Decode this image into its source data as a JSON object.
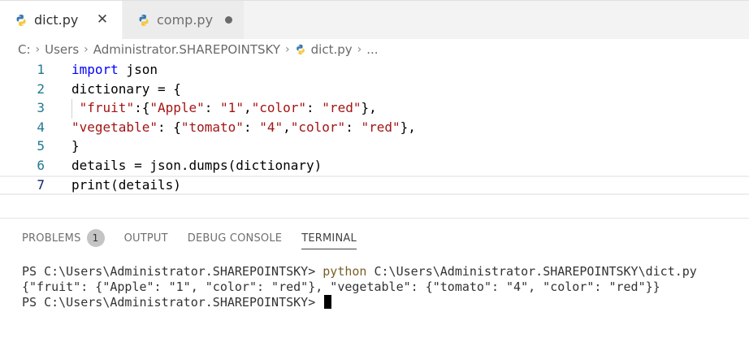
{
  "tabs": [
    {
      "label": "dict.py",
      "icon": "python-icon",
      "active": true,
      "close_symbol": "✕"
    },
    {
      "label": "comp.py",
      "icon": "python-icon",
      "active": false,
      "modified": true
    }
  ],
  "breadcrumb": {
    "items": [
      "C:",
      "Users",
      "Administrator.SHAREPOINTSKY",
      "dict.py",
      "..."
    ],
    "separator": "›"
  },
  "editor": {
    "lines": [
      {
        "number": "1",
        "parts": [
          {
            "t": "import",
            "c": "kw"
          },
          {
            "t": " json",
            "c": ""
          }
        ]
      },
      {
        "number": "2",
        "parts": [
          {
            "t": "dictionary = {",
            "c": ""
          }
        ]
      },
      {
        "number": "3",
        "parts": [
          {
            "t": " ",
            "c": ""
          },
          {
            "t": "\"fruit\"",
            "c": "str"
          },
          {
            "t": ":{",
            "c": ""
          },
          {
            "t": "\"Apple\"",
            "c": "str"
          },
          {
            "t": ": ",
            "c": ""
          },
          {
            "t": "\"1\"",
            "c": "str"
          },
          {
            "t": ",",
            "c": ""
          },
          {
            "t": "\"color\"",
            "c": "str"
          },
          {
            "t": ": ",
            "c": ""
          },
          {
            "t": "\"red\"",
            "c": "str"
          },
          {
            "t": "},",
            "c": ""
          }
        ]
      },
      {
        "number": "4",
        "parts": [
          {
            "t": "\"vegetable\"",
            "c": "str"
          },
          {
            "t": ": {",
            "c": ""
          },
          {
            "t": "\"tomato\"",
            "c": "str"
          },
          {
            "t": ": ",
            "c": ""
          },
          {
            "t": "\"4\"",
            "c": "str"
          },
          {
            "t": ",",
            "c": ""
          },
          {
            "t": "\"color\"",
            "c": "str"
          },
          {
            "t": ": ",
            "c": ""
          },
          {
            "t": "\"red\"",
            "c": "str"
          },
          {
            "t": "},",
            "c": ""
          }
        ]
      },
      {
        "number": "5",
        "parts": [
          {
            "t": "}",
            "c": ""
          }
        ]
      },
      {
        "number": "6",
        "parts": [
          {
            "t": "details = json.dumps(dictionary)",
            "c": ""
          }
        ]
      },
      {
        "number": "7",
        "parts": [
          {
            "t": "print(details)",
            "c": ""
          }
        ],
        "current": true
      }
    ]
  },
  "panel": {
    "tabs": [
      {
        "label": "PROBLEMS",
        "badge": "1",
        "active": false
      },
      {
        "label": "OUTPUT",
        "active": false
      },
      {
        "label": "DEBUG CONSOLE",
        "active": false
      },
      {
        "label": "TERMINAL",
        "active": true
      }
    ],
    "terminal": {
      "prompt": "PS C:\\Users\\Administrator.SHAREPOINTSKY> ",
      "command": "python",
      "command_args": " C:\\Users\\Administrator.SHAREPOINTSKY\\dict.py",
      "output": "{\"fruit\": {\"Apple\": \"1\", \"color\": \"red\"}, \"vegetable\": {\"tomato\": \"4\", \"color\": \"red\"}}",
      "prompt2": "PS C:\\Users\\Administrator.SHAREPOINTSKY> "
    }
  },
  "colors": {
    "keyword": "#0000ff",
    "string": "#a31515",
    "line_number": "#237893",
    "python_icon_blue": "#3a78b0",
    "python_icon_yellow": "#f5c83b"
  }
}
